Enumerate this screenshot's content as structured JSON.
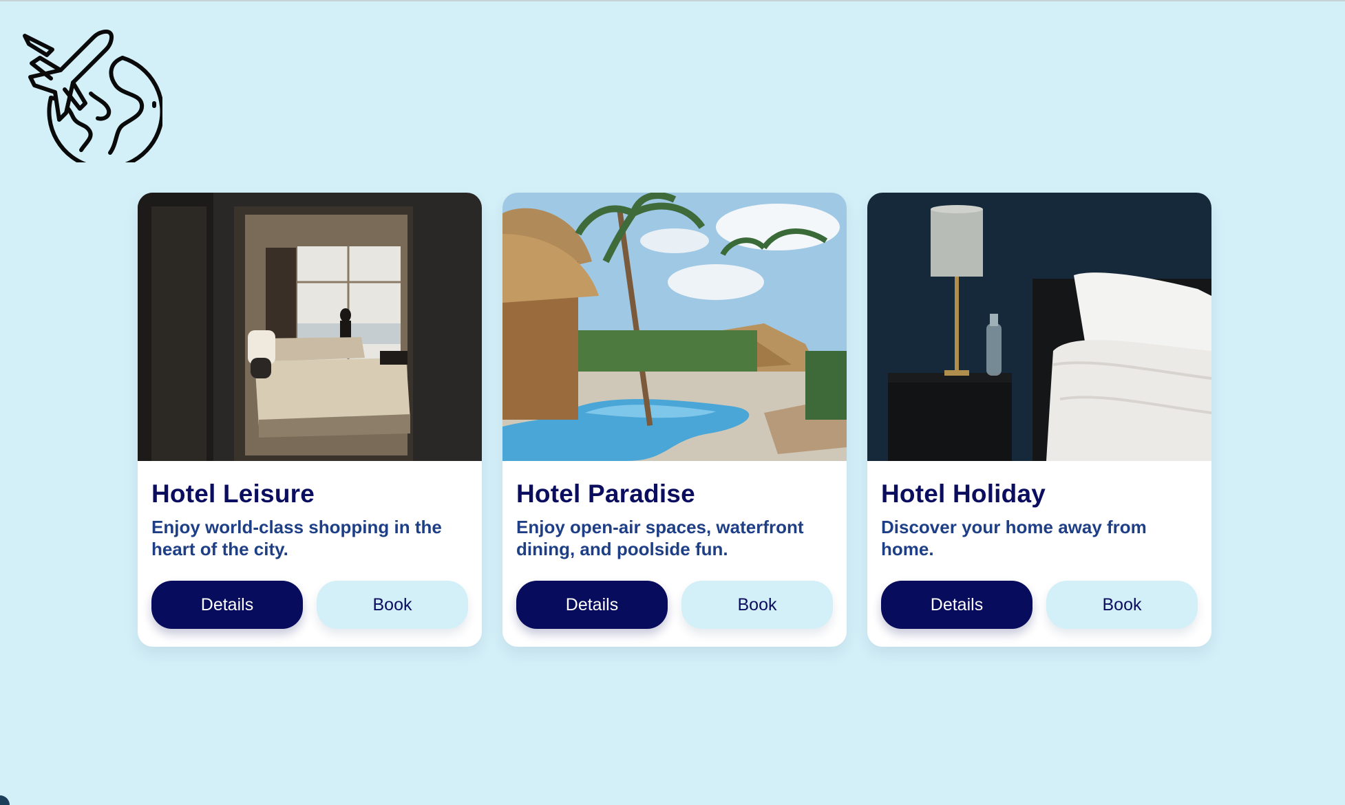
{
  "app": {
    "logo_icon": "airplane-globe-icon"
  },
  "colors": {
    "background": "#d3eff8",
    "card": "#ffffff",
    "title": "#0b0d5e",
    "description": "#1e3f86",
    "details_button": "#080c5c",
    "book_button": "#d3eff8"
  },
  "cards": [
    {
      "title": "Hotel Leisure",
      "description": "Enjoy world-class shopping in the heart of the city.",
      "image": "hotel-room-window-photo",
      "details_label": "Details",
      "book_label": "Book"
    },
    {
      "title": "Hotel Paradise",
      "description": "Enjoy open-air spaces, waterfront dining, and poolside fun.",
      "image": "tropical-pool-photo",
      "details_label": "Details",
      "book_label": "Book"
    },
    {
      "title": "Hotel Holiday",
      "description": "Discover your home away from home.",
      "image": "bedside-lamp-photo",
      "details_label": "Details",
      "book_label": "Book"
    }
  ]
}
